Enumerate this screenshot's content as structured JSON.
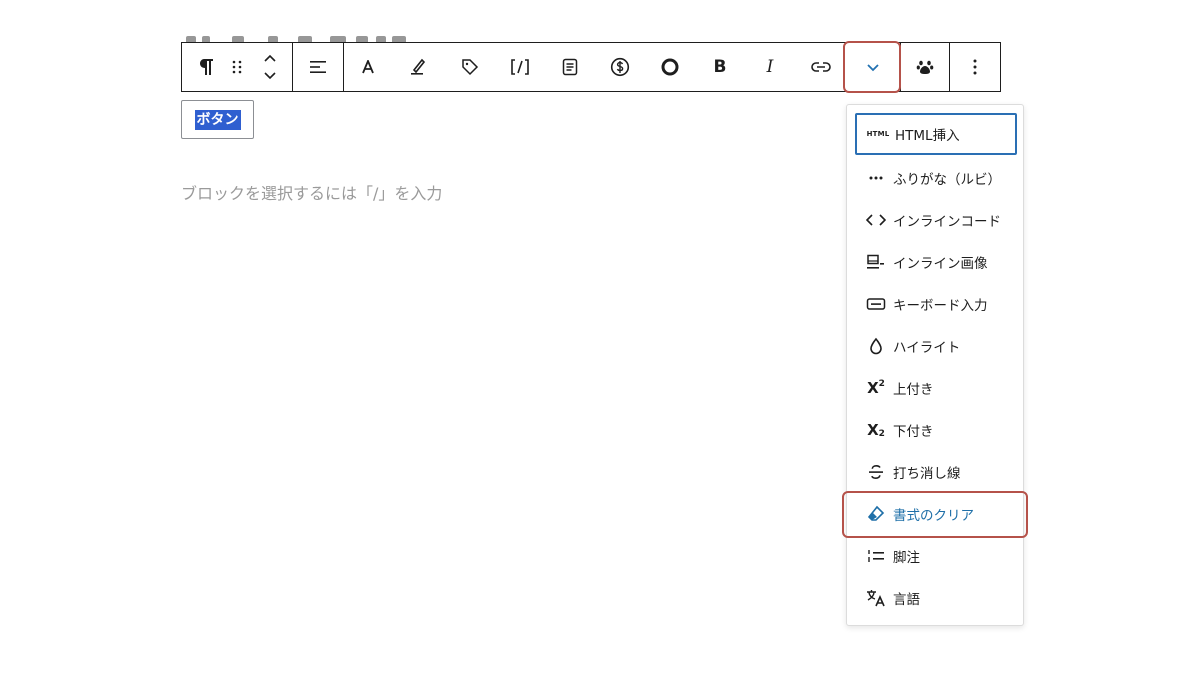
{
  "toolbar": {
    "paragraph_icon": "pilcrow-icon",
    "drag_icon": "drag-handle-icon",
    "move_icon": "move-up-down-icon",
    "align_icon": "align-icon",
    "font_icon": "font-icon",
    "highlighter_icon": "highlighter-icon",
    "tag_icon": "tag-icon",
    "shortcode_icon": "shortcode-icon",
    "document_icon": "document-icon",
    "dollar_icon": "dollar-circle-icon",
    "circle_icon": "circle-icon",
    "bold_label": "B",
    "italic_label": "I",
    "link_icon": "link-icon",
    "more_icon": "chevron-down-icon",
    "paw_icon": "paw-icon",
    "options_icon": "more-vertical-icon",
    "accent_color": "#2271b1",
    "highlight_color": "#b5524a"
  },
  "button_block": {
    "label": "ボタン",
    "selection_color": "#2f5fd0"
  },
  "editor": {
    "placeholder": "ブロックを選択するには「/」を入力"
  },
  "dropdown": {
    "items": [
      {
        "label": "HTML挿入",
        "icon": "html-icon",
        "icon_text": "HTML"
      },
      {
        "label": "ふりがな（ルビ）",
        "icon": "ellipsis-icon"
      },
      {
        "label": "インラインコード",
        "icon": "code-icon"
      },
      {
        "label": "インライン画像",
        "icon": "inline-image-icon"
      },
      {
        "label": "キーボード入力",
        "icon": "keyboard-icon"
      },
      {
        "label": "ハイライト",
        "icon": "drop-icon"
      },
      {
        "label": "上付き",
        "icon": "superscript-icon"
      },
      {
        "label": "下付き",
        "icon": "subscript-icon"
      },
      {
        "label": "打ち消し線",
        "icon": "strikethrough-icon"
      },
      {
        "label": "書式のクリア",
        "icon": "eraser-icon"
      },
      {
        "label": "脚注",
        "icon": "footnote-icon"
      },
      {
        "label": "言語",
        "icon": "language-icon"
      }
    ]
  }
}
